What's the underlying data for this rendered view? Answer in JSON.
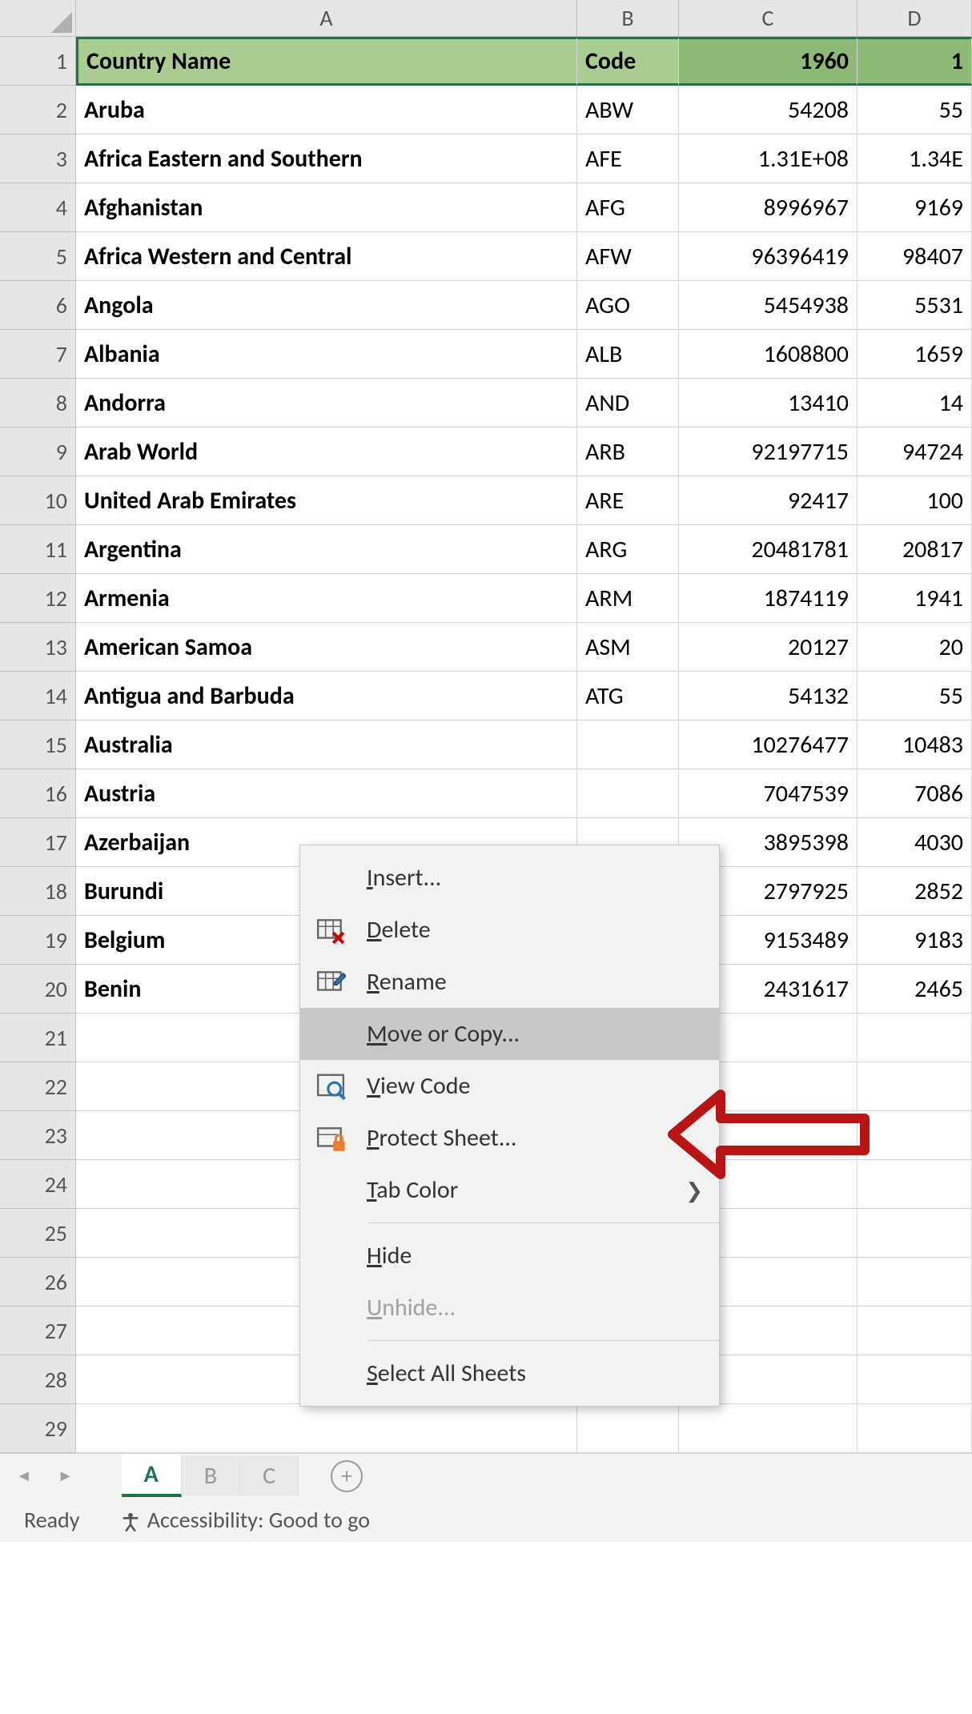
{
  "columns": [
    "A",
    "B",
    "C",
    "D"
  ],
  "header_row": {
    "A": "Country Name",
    "B": "Code",
    "C": "1960",
    "D": "1"
  },
  "rows": [
    {
      "n": "2",
      "A": "Aruba",
      "B": "ABW",
      "C": "54208",
      "D": "55"
    },
    {
      "n": "3",
      "A": "Africa Eastern and Southern",
      "B": "AFE",
      "C": "1.31E+08",
      "D": "1.34E"
    },
    {
      "n": "4",
      "A": "Afghanistan",
      "B": "AFG",
      "C": "8996967",
      "D": "9169"
    },
    {
      "n": "5",
      "A": "Africa Western and Central",
      "B": "AFW",
      "C": "96396419",
      "D": "98407"
    },
    {
      "n": "6",
      "A": "Angola",
      "B": "AGO",
      "C": "5454938",
      "D": "5531"
    },
    {
      "n": "7",
      "A": "Albania",
      "B": "ALB",
      "C": "1608800",
      "D": "1659"
    },
    {
      "n": "8",
      "A": "Andorra",
      "B": "AND",
      "C": "13410",
      "D": "14"
    },
    {
      "n": "9",
      "A": "Arab World",
      "B": "ARB",
      "C": "92197715",
      "D": "94724"
    },
    {
      "n": "10",
      "A": "United Arab Emirates",
      "B": "ARE",
      "C": "92417",
      "D": "100"
    },
    {
      "n": "11",
      "A": "Argentina",
      "B": "ARG",
      "C": "20481781",
      "D": "20817"
    },
    {
      "n": "12",
      "A": "Armenia",
      "B": "ARM",
      "C": "1874119",
      "D": "1941"
    },
    {
      "n": "13",
      "A": "American Samoa",
      "B": "ASM",
      "C": "20127",
      "D": "20"
    },
    {
      "n": "14",
      "A": "Antigua and Barbuda",
      "B": "ATG",
      "C": "54132",
      "D": "55"
    },
    {
      "n": "15",
      "A": "Australia",
      "B": "",
      "C": "10276477",
      "D": "10483"
    },
    {
      "n": "16",
      "A": "Austria",
      "B": "",
      "C": "7047539",
      "D": "7086"
    },
    {
      "n": "17",
      "A": "Azerbaijan",
      "B": "",
      "C": "3895398",
      "D": "4030"
    },
    {
      "n": "18",
      "A": "Burundi",
      "B": "",
      "C": "2797925",
      "D": "2852"
    },
    {
      "n": "19",
      "A": "Belgium",
      "B": "",
      "C": "9153489",
      "D": "9183"
    },
    {
      "n": "20",
      "A": "Benin",
      "B": "",
      "C": "2431617",
      "D": "2465"
    },
    {
      "n": "21",
      "A": "",
      "B": "",
      "C": "",
      "D": ""
    },
    {
      "n": "22",
      "A": "",
      "B": "",
      "C": "",
      "D": ""
    },
    {
      "n": "23",
      "A": "",
      "B": "",
      "C": "",
      "D": ""
    },
    {
      "n": "24",
      "A": "",
      "B": "",
      "C": "",
      "D": ""
    },
    {
      "n": "25",
      "A": "",
      "B": "",
      "C": "",
      "D": ""
    },
    {
      "n": "26",
      "A": "",
      "B": "",
      "C": "",
      "D": ""
    },
    {
      "n": "27",
      "A": "",
      "B": "",
      "C": "",
      "D": ""
    },
    {
      "n": "28",
      "A": "",
      "B": "",
      "C": "",
      "D": ""
    },
    {
      "n": "29",
      "A": "",
      "B": "",
      "C": "",
      "D": ""
    }
  ],
  "context_menu": {
    "insert": "Insert...",
    "delete": "Delete",
    "rename": "Rename",
    "move_copy": "Move or Copy...",
    "view_code": "View Code",
    "protect": "Protect Sheet...",
    "tab_color": "Tab Color",
    "hide": "Hide",
    "unhide": "Unhide...",
    "select_all": "Select All Sheets"
  },
  "sheet_tabs": [
    "A",
    "B",
    "C"
  ],
  "active_tab_index": 0,
  "status_bar": {
    "ready": "Ready",
    "accessibility": "Accessibility: Good to go"
  }
}
